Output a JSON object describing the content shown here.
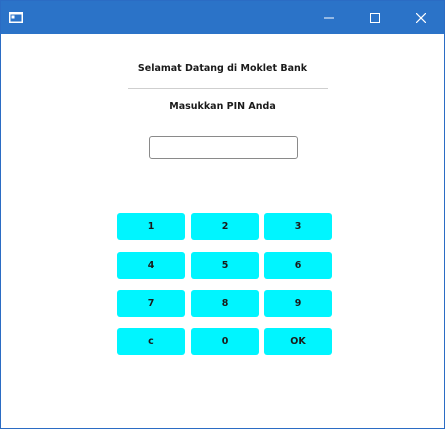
{
  "window": {
    "title": "",
    "controls": [
      "minimize",
      "maximize",
      "close"
    ]
  },
  "main": {
    "welcome": "Selamat Datang di Moklet Bank",
    "prompt": "Masukkan PIN Anda",
    "pin_value": ""
  },
  "keypad": {
    "rows": [
      [
        "1",
        "2",
        "3"
      ],
      [
        "4",
        "5",
        "6"
      ],
      [
        "7",
        "8",
        "9"
      ],
      [
        "c",
        "0",
        "OK"
      ]
    ],
    "key_color": "#00f5ff"
  },
  "colors": {
    "titlebar": "#2b73c8",
    "background": "#ffffff"
  }
}
